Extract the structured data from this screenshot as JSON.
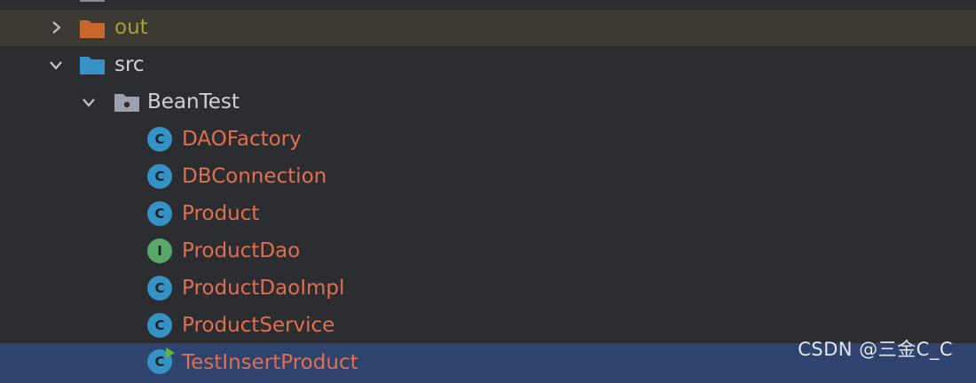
{
  "tree": {
    "out_folder": {
      "label": "out",
      "expanded": false,
      "icon": "folder-excluded-icon",
      "color": "#c9682c"
    },
    "src_folder": {
      "label": "src",
      "expanded": true,
      "icon": "folder-source-icon",
      "color": "#3592c4"
    },
    "package": {
      "label": "BeanTest",
      "expanded": true,
      "icon": "package-folder-icon",
      "color": "#9aa3ad"
    },
    "classes": [
      {
        "label": "DAOFactory",
        "icon_letter": "C",
        "kind": "class"
      },
      {
        "label": "DBConnection",
        "icon_letter": "C",
        "kind": "class"
      },
      {
        "label": "Product",
        "icon_letter": "C",
        "kind": "class"
      },
      {
        "label": "ProductDao",
        "icon_letter": "I",
        "kind": "interface"
      },
      {
        "label": "ProductDaoImpl",
        "icon_letter": "C",
        "kind": "class"
      },
      {
        "label": "ProductService",
        "icon_letter": "C",
        "kind": "class"
      },
      {
        "label": "TestInsertProduct",
        "icon_letter": "C",
        "kind": "runnable-class"
      }
    ]
  },
  "colors": {
    "background": "#2b2d30",
    "excluded_row": "#3d3a34",
    "selected_row": "#2e436e",
    "modified_file_text": "#e06f4f",
    "excluded_text": "#a3a335",
    "class_icon": "#3592c4",
    "interface_icon": "#59a869"
  },
  "watermark": "CSDN @三金C_C"
}
